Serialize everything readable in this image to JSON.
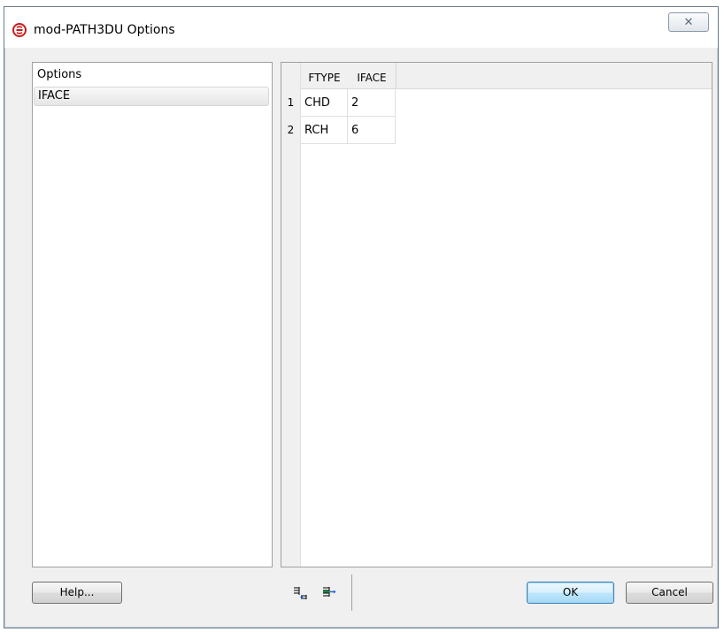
{
  "window": {
    "title": "mod-PATH3DU Options",
    "close_glyph": "✕"
  },
  "options": {
    "header": "Options",
    "items": [
      "IFACE"
    ]
  },
  "table": {
    "columns": [
      "FTYPE",
      "IFACE"
    ],
    "rows": [
      {
        "num": "1",
        "ftype": "CHD",
        "iface": "2"
      },
      {
        "num": "2",
        "ftype": "RCH",
        "iface": "6"
      }
    ]
  },
  "toolbar": {
    "insert_row_icon": "insert-row-icon",
    "append_row_icon": "append-row-icon"
  },
  "buttons": {
    "help": "Help...",
    "ok": "OK",
    "cancel": "Cancel"
  },
  "colors": {
    "app_icon": "#cc1b1b",
    "accent": "#3c7fb1"
  }
}
